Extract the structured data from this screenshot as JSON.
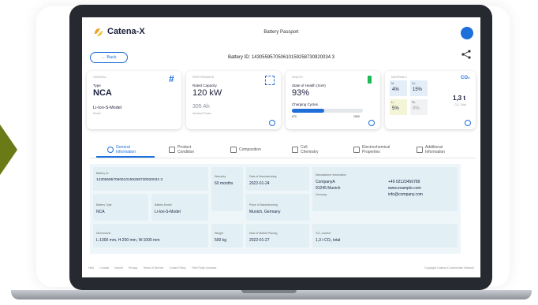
{
  "app": {
    "logo_text": "Catena-X",
    "title": "Battery Passport",
    "back_label": "Back",
    "battery_id": "Battery ID: 143055957050610159258730920034 3"
  },
  "cards": {
    "type": {
      "label": "GENERAL",
      "title": "Type",
      "value": "NCA",
      "model": "Li-Ion-S-Model",
      "model_label": "Model"
    },
    "capacity": {
      "label": "PERFORMANCE",
      "title": "Rated Capacity",
      "value": "120 kW",
      "sub_value": "305 Ah",
      "sub_label": "Nominal Power"
    },
    "health": {
      "label": "HEALTH",
      "title": "State of Health (SoH)",
      "value": "93%",
      "cycles_label": "Charging Cycles",
      "cycles_min": "670",
      "cycles_max": "1500",
      "cycles_fraction": 0.45
    },
    "materials": {
      "label": "MATERIALS",
      "unit": "CO₂",
      "items": [
        {
          "el": "Ni",
          "pct": "4%"
        },
        {
          "el": "Co",
          "pct": "15%"
        },
        {
          "el": "Li",
          "pct": "5%"
        },
        {
          "el": "Pb",
          "pct": "0%"
        }
      ],
      "weight": "1,3 t",
      "weight_label": "CO₂ Total"
    }
  },
  "tabs": [
    {
      "label": "General Information"
    },
    {
      "label": "Product Condition"
    },
    {
      "label": "Composition"
    },
    {
      "label": "Cell Chemistry"
    },
    {
      "label": "Electrochemical Properties"
    },
    {
      "label": "Additional Information"
    }
  ],
  "details": {
    "battery_id_label": "Battery ID",
    "battery_id_value": "143055957050610159258730920034 3",
    "warranty_label": "Warranty",
    "warranty_value": "60 months",
    "manufacturing_date_label": "Date of Manufacturing",
    "manufacturing_date_value": "2022-01-24",
    "manufacturer_label": "Manufacturer information",
    "manufacturer_name": "CompanyA",
    "manufacturer_city": "91245 Munich",
    "manufacturer_country": "Germany",
    "manufacturer_phone": "+49 02123456789",
    "manufacturer_web": "www.example.com",
    "manufacturer_email": "info@company.com",
    "battery_type_label": "Battery Type",
    "battery_type_value": "NCA",
    "battery_model_label": "Battery Model",
    "battery_model_value": "Li-Ion-S-Model",
    "place_label": "Place of Manufacturing",
    "place_value": "Munich, Germany",
    "dimensions_label": "Dimensions",
    "dimensions_value": "L:1000 mm, H:200 mm, W:1000 mm",
    "weight_label": "Weight",
    "weight_value": "500 kg",
    "market_label": "Date of Market Placing",
    "market_value": "2022-01-27",
    "co2_label": "CO₂ content",
    "co2_value": "1,3 t CO₂ total"
  },
  "footer": {
    "links": [
      "Help",
      "Contact",
      "Imprint",
      "Privacy",
      "Terms of Service",
      "Cookie Policy",
      "Third Party Licenses"
    ],
    "copyright": "Copyright Catena-X Automotive Network"
  }
}
